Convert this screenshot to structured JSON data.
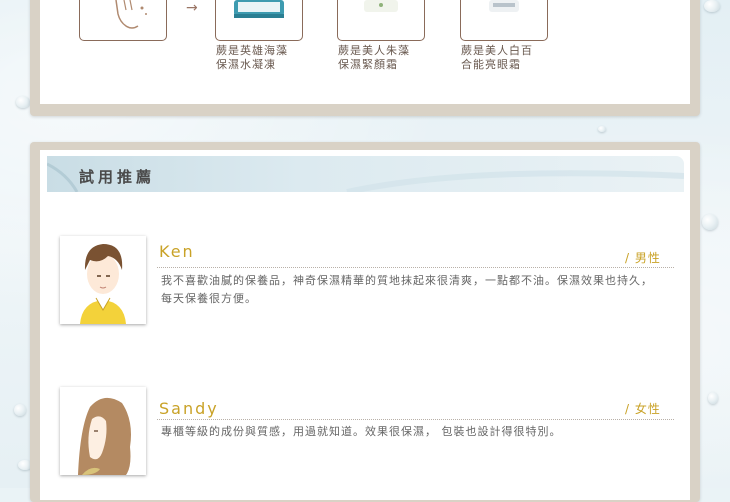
{
  "products": [
    {
      "icon": "hand-icon",
      "label": ""
    },
    {
      "icon": "jar-icon",
      "label": "蕨是英雄海藻\n保濕水凝凍"
    },
    {
      "icon": "jar-icon",
      "label": "蕨是美人朱藻\n保濕緊顏霜"
    },
    {
      "icon": "jar-icon",
      "label": "蕨是美人白百\n合能亮眼霜"
    }
  ],
  "arrow": "→",
  "section": {
    "title": "試用推薦"
  },
  "reviews": [
    {
      "name": "Ken",
      "gender": "/ 男性",
      "text": "我不喜歡油膩的保養品，神奇保濕精華的質地抹起來很清爽，一點都不油。保濕效果也持久，每天保養很方便。"
    },
    {
      "name": "Sandy",
      "gender": "/ 女性",
      "text": "專櫃等級的成份與質感，用過就知道。效果很保濕， 包裝也設計得很特別。"
    }
  ],
  "colors": {
    "accent": "#c9a227",
    "frame": "#d9d2c6",
    "box_border": "#8a6b5a"
  }
}
